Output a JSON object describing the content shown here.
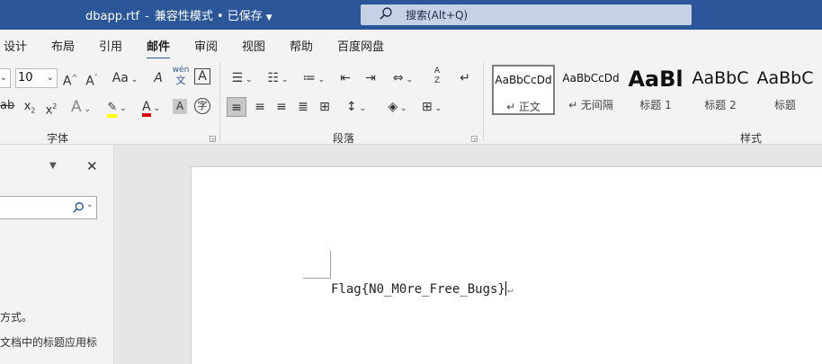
{
  "titlebar": {
    "filename": "dbapp.rtf",
    "separator": "-",
    "mode": "兼容性模式 • 已保存",
    "search_placeholder": "搜索(Alt+Q)"
  },
  "tabs": [
    "设计",
    "布局",
    "引用",
    "邮件",
    "审阅",
    "视图",
    "帮助",
    "百度网盘"
  ],
  "active_tab": "邮件",
  "ribbon": {
    "font": {
      "size": "10",
      "grow_label": "A",
      "shrink_label": "A",
      "case_label": "Aa",
      "phonetic_top": "wén",
      "phonetic_bottom": "文",
      "border_char": "A",
      "strike": "ab",
      "subscript": "x",
      "superscript": "x",
      "effects": "A",
      "font_color": "A",
      "char_shading": "A",
      "enclose": "字",
      "group_label": "字体"
    },
    "paragraph": {
      "sort_label": "AZ",
      "group_label": "段落"
    },
    "styles": {
      "group_label": "样式",
      "items": [
        {
          "sample": "AaBbCcDd",
          "name": "↵ 正文"
        },
        {
          "sample": "AaBbCcDd",
          "name": "↵ 无间隔"
        },
        {
          "sample": "AaBl",
          "name": "标题 1"
        },
        {
          "sample": "AaBbC",
          "name": "标题 2"
        },
        {
          "sample": "AaBbC",
          "name": "标题"
        }
      ]
    }
  },
  "nav_pane": {
    "text_line1": "方式。",
    "text_line2": "文档中的标题应用标"
  },
  "document": {
    "text": "Flag{N0_M0re_Free_Bugs}",
    "para_mark": "↵"
  },
  "colors": {
    "titlebar": "#2b579a",
    "highlight": "#ffff00",
    "font_color": "#e00000"
  }
}
